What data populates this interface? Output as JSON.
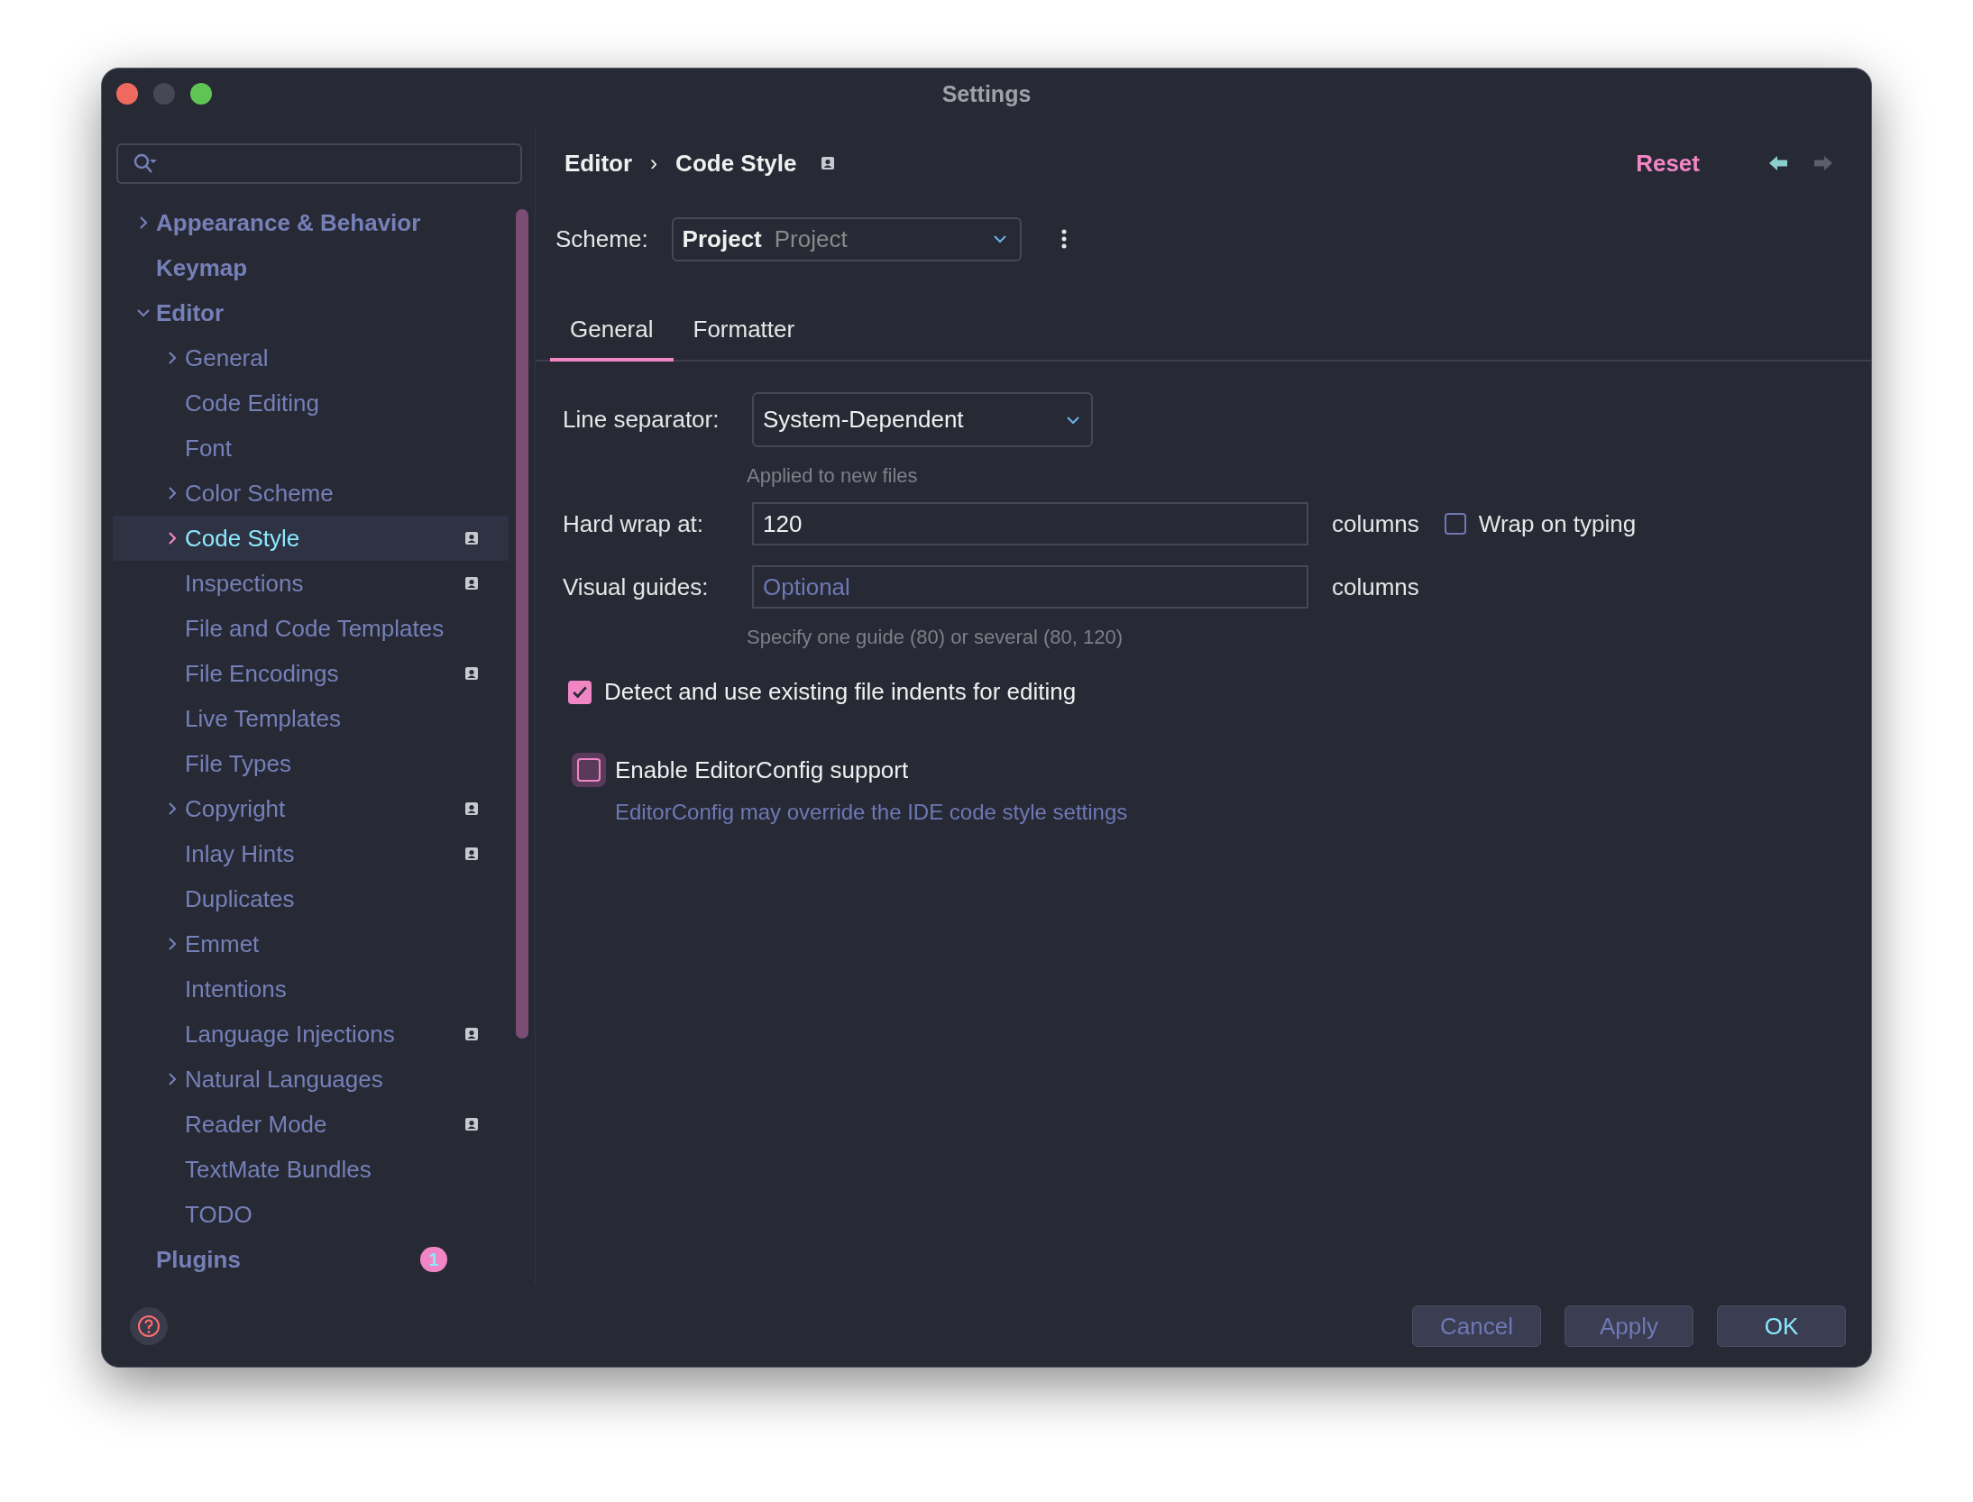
{
  "window": {
    "title": "Settings"
  },
  "sidebar": {
    "items": [
      {
        "label": "Appearance & Behavior",
        "kind": "group",
        "expanded": false,
        "selected": false,
        "project_scoped": false
      },
      {
        "label": "Keymap",
        "kind": "leaf",
        "selected": false,
        "project_scoped": false
      },
      {
        "label": "Editor",
        "kind": "group",
        "expanded": true,
        "selected": false,
        "project_scoped": false,
        "children": [
          {
            "label": "General",
            "kind": "group",
            "expanded": false,
            "selected": false,
            "project_scoped": false
          },
          {
            "label": "Code Editing",
            "kind": "leaf",
            "selected": false,
            "project_scoped": false
          },
          {
            "label": "Font",
            "kind": "leaf",
            "selected": false,
            "project_scoped": false
          },
          {
            "label": "Color Scheme",
            "kind": "group",
            "expanded": false,
            "selected": false,
            "project_scoped": false
          },
          {
            "label": "Code Style",
            "kind": "group",
            "expanded": false,
            "selected": true,
            "project_scoped": true
          },
          {
            "label": "Inspections",
            "kind": "leaf",
            "selected": false,
            "project_scoped": true
          },
          {
            "label": "File and Code Templates",
            "kind": "leaf",
            "selected": false,
            "project_scoped": false
          },
          {
            "label": "File Encodings",
            "kind": "leaf",
            "selected": false,
            "project_scoped": true
          },
          {
            "label": "Live Templates",
            "kind": "leaf",
            "selected": false,
            "project_scoped": false
          },
          {
            "label": "File Types",
            "kind": "leaf",
            "selected": false,
            "project_scoped": false
          },
          {
            "label": "Copyright",
            "kind": "group",
            "expanded": false,
            "selected": false,
            "project_scoped": true
          },
          {
            "label": "Inlay Hints",
            "kind": "leaf",
            "selected": false,
            "project_scoped": true
          },
          {
            "label": "Duplicates",
            "kind": "leaf",
            "selected": false,
            "project_scoped": false
          },
          {
            "label": "Emmet",
            "kind": "group",
            "expanded": false,
            "selected": false,
            "project_scoped": false
          },
          {
            "label": "Intentions",
            "kind": "leaf",
            "selected": false,
            "project_scoped": false
          },
          {
            "label": "Language Injections",
            "kind": "leaf",
            "selected": false,
            "project_scoped": true
          },
          {
            "label": "Natural Languages",
            "kind": "group",
            "expanded": false,
            "selected": false,
            "project_scoped": false
          },
          {
            "label": "Reader Mode",
            "kind": "leaf",
            "selected": false,
            "project_scoped": true
          },
          {
            "label": "TextMate Bundles",
            "kind": "leaf",
            "selected": false,
            "project_scoped": false
          },
          {
            "label": "TODO",
            "kind": "leaf",
            "selected": false,
            "project_scoped": false
          }
        ]
      },
      {
        "label": "Plugins",
        "kind": "leaf",
        "selected": false,
        "project_scoped": false,
        "badge": "1"
      }
    ]
  },
  "header": {
    "breadcrumb": [
      "Editor",
      "Code Style"
    ],
    "separator": "›",
    "project_scoped": true,
    "reset": "Reset",
    "back_enabled": true,
    "forward_enabled": false
  },
  "scheme": {
    "label": "Scheme:",
    "value": "Project",
    "detail": "Project"
  },
  "tabs": [
    {
      "label": "General",
      "selected": true
    },
    {
      "label": "Formatter",
      "selected": false
    }
  ],
  "fields": [
    {
      "kind": "dropdown",
      "label": "Line separator:",
      "value": "System-Dependent",
      "hint": "Applied to new files"
    },
    {
      "kind": "text",
      "label": "Hard wrap at:",
      "value": "120",
      "unit": "columns",
      "checkbox": {
        "label": "Wrap on typing",
        "checked": false
      }
    },
    {
      "kind": "text",
      "label": "Visual guides:",
      "placeholder": "Optional",
      "unit": "columns",
      "hint": "Specify one guide (80) or several (80, 120)"
    }
  ],
  "options": [
    {
      "label": "Detect and use existing file indents for editing",
      "checked": true,
      "focused": false
    },
    {
      "label": "Enable EditorConfig support",
      "checked": false,
      "focused": true,
      "description": "EditorConfig may override the IDE code style settings"
    }
  ],
  "buttons": [
    {
      "label": "Cancel",
      "default": false
    },
    {
      "label": "Apply",
      "default": false
    },
    {
      "label": "OK",
      "default": true
    }
  ]
}
